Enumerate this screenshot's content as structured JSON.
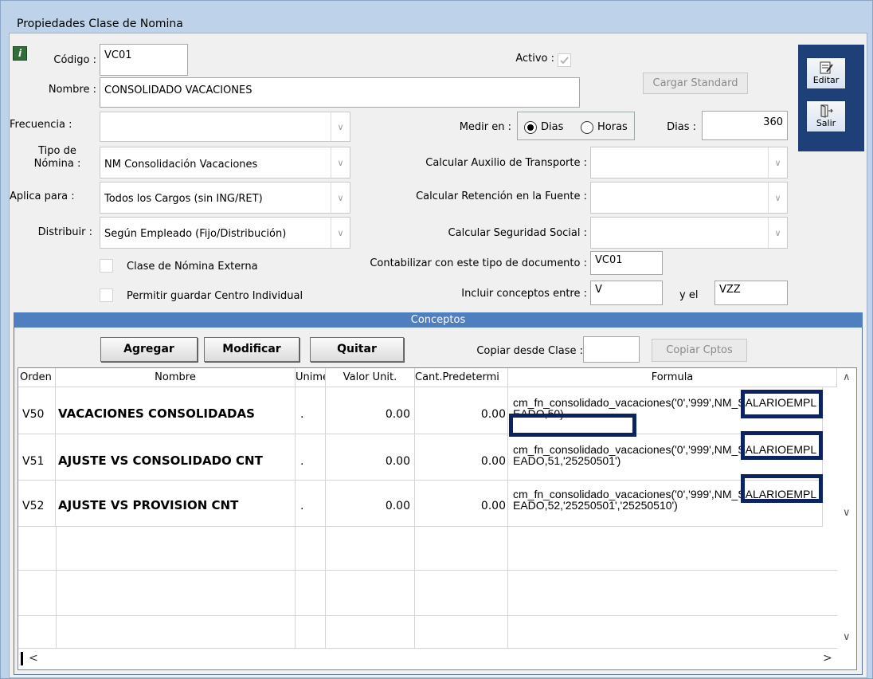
{
  "window": {
    "title": "Propiedades Clase de Nomina"
  },
  "form": {
    "codigo_label": "Código :",
    "codigo_value": "VC01",
    "activo_label": "Activo :",
    "nombre_label": "Nombre :",
    "nombre_value": "CONSOLIDADO VACACIONES",
    "cargar_standard": "Cargar Standard",
    "frecuencia_label": "Frecuencia :",
    "frecuencia_value": "",
    "medir_label": "Medir en :",
    "medir_dias": "Dias",
    "medir_horas": "Horas",
    "dias_label": "Dias :",
    "dias_value": "360",
    "tipo_label_1": "Tipo de",
    "tipo_label_2": "Nómina :",
    "tipo_value": "NM Consolidación Vacaciones",
    "auxilio_label": "Calcular Auxilio de Transporte :",
    "auxilio_value": "",
    "aplica_label": "Aplica para :",
    "aplica_value": "Todos los Cargos (sin ING/RET)",
    "retencion_label": "Calcular Retención en la Fuente :",
    "retencion_value": "",
    "distribuir_label": "Distribuir :",
    "distribuir_value": "Según Empleado (Fijo/Distribución)",
    "seguridad_label": "Calcular Seguridad Social :",
    "seguridad_value": "",
    "externa_label": "Clase de Nómina Externa",
    "contabilizar_label": "Contabilizar con este tipo de documento :",
    "contabilizar_value": "VC01",
    "permitir_label": "Permitir guardar Centro Individual",
    "incluir_label": "Incluir conceptos entre :",
    "incluir_from": "V",
    "y_el_label": "y el",
    "incluir_to": "VZZ"
  },
  "side": {
    "editar": "Editar",
    "salir": "Salir"
  },
  "conceptos": {
    "header": "Conceptos",
    "agregar": "Agregar",
    "modificar": "Modificar",
    "quitar": "Quitar",
    "copiar_label": "Copiar desde Clase :",
    "copiar_value": "",
    "copiar_btn": "Copiar Cptos"
  },
  "grid": {
    "columns": [
      "Orden",
      "Nombre",
      "Unimed",
      "Valor Unit.",
      "Cant.Predetermi",
      "Formula"
    ],
    "rows": [
      {
        "orden": "V50",
        "nombre": "VACACIONES CONSOLIDADAS",
        "unimed": ".",
        "valor": "0.00",
        "cant": "0.00",
        "formula": "cm_fn_consolidado_vacaciones('0','999',NM_SALARIOEMPLEADO,50)"
      },
      {
        "orden": "V51",
        "nombre": "AJUSTE VS CONSOLIDADO CNT",
        "unimed": ".",
        "valor": "0.00",
        "cant": "0.00",
        "formula": "cm_fn_consolidado_vacaciones('0','999',NM_SALARIOEMPLEADO,51,'25250501')"
      },
      {
        "orden": "V52",
        "nombre": "AJUSTE VS PROVISION CNT",
        "unimed": ".",
        "valor": "0.00",
        "cant": "0.00",
        "formula": "cm_fn_consolidado_vacaciones('0','999',NM_SALARIOEMPLEADO,52,'25250501','25250510')"
      }
    ]
  },
  "icons": {
    "info": "info-icon",
    "editar": "edit-document-icon",
    "salir": "exit-door-icon",
    "scroll_up": "chevron-up-icon",
    "scroll_down": "chevron-down-icon",
    "scroll_left": "chevron-left-icon",
    "scroll_right": "chevron-right-icon",
    "dropdown": "chevron-down-icon"
  },
  "colors": {
    "window_bg": "#bed3ea",
    "section_header": "#4f7fbf",
    "highlight_box": "#0d2360"
  }
}
